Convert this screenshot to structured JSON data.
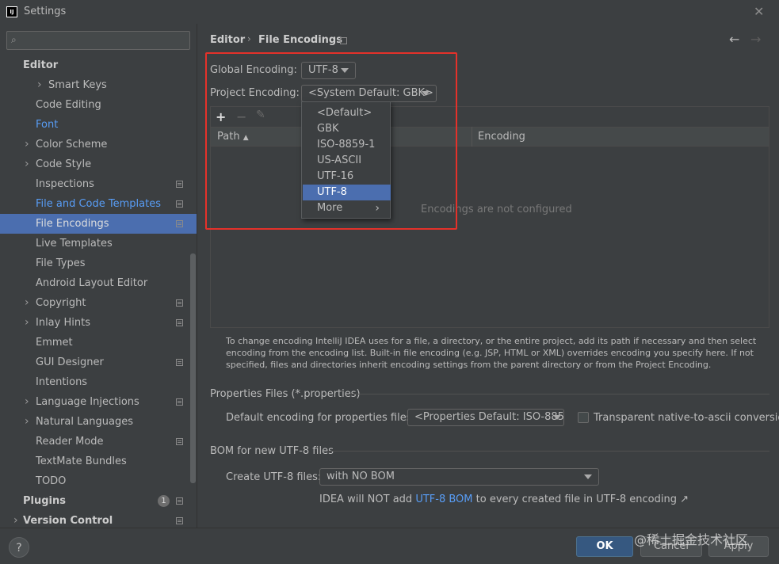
{
  "window": {
    "title": "Settings",
    "logo": "IJ"
  },
  "sidebar": {
    "search_placeholder": "",
    "items": [
      {
        "label": "Editor",
        "indent": 0,
        "bold": true
      },
      {
        "label": "Smart Keys",
        "indent": 2,
        "expand": true
      },
      {
        "label": "Code Editing",
        "indent": 1
      },
      {
        "label": "Font",
        "indent": 1,
        "link": true
      },
      {
        "label": "Color Scheme",
        "indent": 1,
        "expand": true
      },
      {
        "label": "Code Style",
        "indent": 1,
        "expand": true
      },
      {
        "label": "Inspections",
        "indent": 1,
        "project": true
      },
      {
        "label": "File and Code Templates",
        "indent": 1,
        "link": true,
        "project": true
      },
      {
        "label": "File Encodings",
        "indent": 1,
        "selected": true,
        "project": true
      },
      {
        "label": "Live Templates",
        "indent": 1
      },
      {
        "label": "File Types",
        "indent": 1
      },
      {
        "label": "Android Layout Editor",
        "indent": 1
      },
      {
        "label": "Copyright",
        "indent": 1,
        "expand": true,
        "project": true
      },
      {
        "label": "Inlay Hints",
        "indent": 1,
        "expand": true,
        "project": true
      },
      {
        "label": "Emmet",
        "indent": 1
      },
      {
        "label": "GUI Designer",
        "indent": 1,
        "project": true
      },
      {
        "label": "Intentions",
        "indent": 1
      },
      {
        "label": "Language Injections",
        "indent": 1,
        "expand": true,
        "project": true
      },
      {
        "label": "Natural Languages",
        "indent": 1,
        "expand": true
      },
      {
        "label": "Reader Mode",
        "indent": 1,
        "project": true
      },
      {
        "label": "TextMate Bundles",
        "indent": 1
      },
      {
        "label": "TODO",
        "indent": 1
      },
      {
        "label": "Plugins",
        "indent": 0,
        "bold": true,
        "badge": "1",
        "project": true
      },
      {
        "label": "Version Control",
        "indent": 0,
        "bold": true,
        "expand": true,
        "project": true
      }
    ]
  },
  "breadcrumb": {
    "parent": "Editor",
    "separator": "›",
    "current": "File Encodings"
  },
  "encoding": {
    "global_label": "Global Encoding:",
    "global_value": "UTF-8",
    "project_label": "Project Encoding:",
    "project_value": "<System Default: GBK>"
  },
  "dropdown": {
    "options": [
      "<Default>",
      "GBK",
      "ISO-8859-1",
      "US-ASCII",
      "UTF-16",
      "UTF-8",
      "More"
    ],
    "selected": "UTF-8"
  },
  "table": {
    "col_path": "Path",
    "col_encoding": "Encoding",
    "empty_text": "Encodings are not configured"
  },
  "help_text": "To change encoding IntelliJ IDEA uses for a file, a directory, or the entire project, add its path if necessary and then select encoding from the encoding list. Built-in file encoding (e.g. JSP, HTML or XML) overrides encoding you specify here. If not specified, files and directories inherit encoding settings from the parent directory or from the Project Encoding.",
  "properties": {
    "section_title": "Properties Files (*.properties)",
    "default_label": "Default encoding for properties files:",
    "default_value": "<Properties Default: ISO-885...",
    "transparent_label": "Transparent native-to-ascii conversion"
  },
  "bom": {
    "section_title": "BOM for new UTF-8 files",
    "create_label": "Create UTF-8 files:",
    "create_value": "with NO BOM",
    "note_prefix": "IDEA will NOT add ",
    "note_link": "UTF-8 BOM",
    "note_suffix": " to every created file in UTF-8 encoding ↗"
  },
  "buttons": {
    "help": "?",
    "ok": "OK",
    "cancel": "Cancel",
    "apply": "Apply"
  },
  "watermark": "@稀土掘金技术社区",
  "colors": {
    "selection": "#4b6eaf",
    "link": "#589df6",
    "highlight_box": "#e5312a",
    "ok_button": "#365880"
  }
}
